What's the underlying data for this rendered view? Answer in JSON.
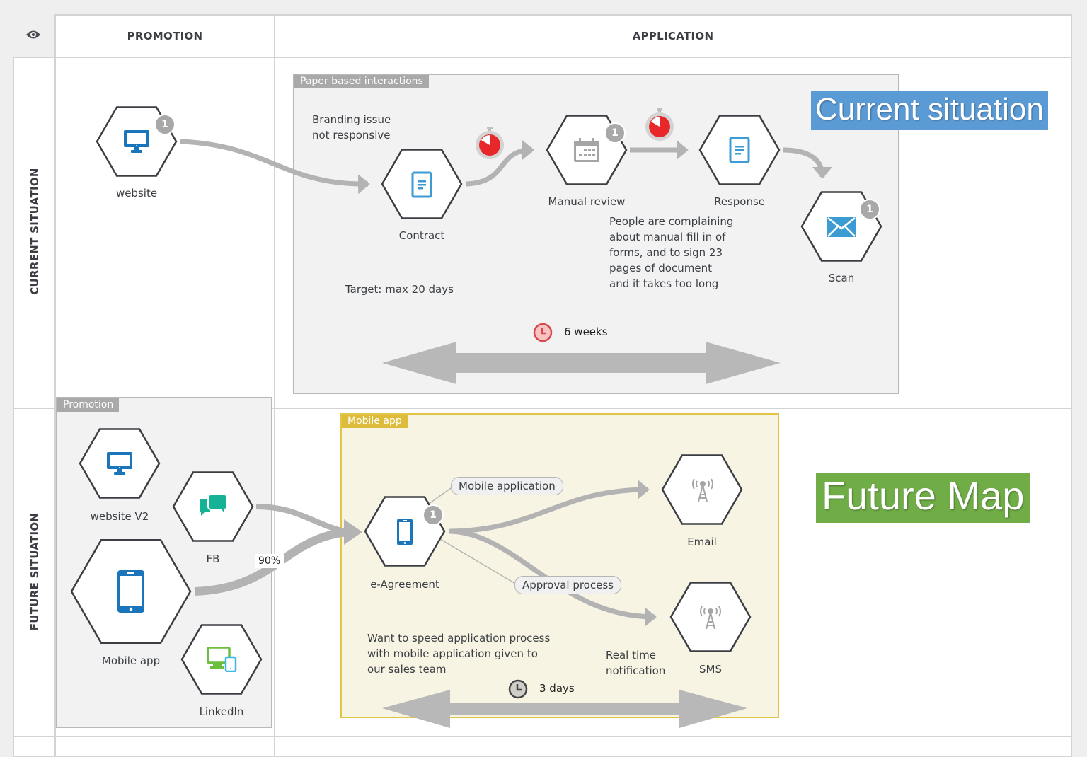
{
  "header": {
    "view_icon": "eye-icon",
    "columns": [
      "PROMOTION",
      "APPLICATION"
    ]
  },
  "rows": [
    "CURRENT SITUATION",
    "FUTURE SITUATION"
  ],
  "colors": {
    "icon_blue": "#1b75bb",
    "icon_light_blue": "#3d9bd3",
    "icon_teal": "#16b296",
    "icon_green": "#6cbf3e",
    "icon_gray": "#a5a5a5",
    "timer_red": "#e8272b",
    "banner_blue": "#5b9bd5",
    "banner_green": "#70ad47",
    "mobile_group_border": "#e2c547"
  },
  "current": {
    "banner": "Current situation",
    "promotion_nodes": [
      {
        "label": "website",
        "icon": "desktop-monitor-icon",
        "badge": "1"
      }
    ],
    "group": {
      "title": "Paper based interactions",
      "nodes": [
        {
          "label": "Contract",
          "icon": "document-icon",
          "badge": null
        },
        {
          "label": "Manual review",
          "icon": "calendar-icon",
          "badge": "1"
        },
        {
          "label": "Response",
          "icon": "document-icon",
          "badge": null
        },
        {
          "label": "Scan",
          "icon": "envelope-icon",
          "badge": "1"
        }
      ],
      "notes": {
        "branding": [
          "Branding issue",
          "not responsive"
        ],
        "complaint": [
          "People are complaining",
          "about manual fill in of",
          "forms, and to sign 23",
          "pages of document",
          "and it takes too long"
        ],
        "target": "Target: max 20 days"
      },
      "timers": [
        "stopwatch-icon",
        "stopwatch-icon"
      ],
      "duration": {
        "icon": "clock-icon",
        "text": "6 weeks"
      }
    }
  },
  "future": {
    "banner": "Future Map",
    "promotion_group": {
      "title": "Promotion",
      "nodes": [
        {
          "label": "website V2",
          "icon": "desktop-monitor-icon"
        },
        {
          "label": "FB",
          "icon": "chat-bubbles-icon"
        },
        {
          "label": "Mobile app",
          "icon": "smartphone-icon"
        },
        {
          "label": "LinkedIn",
          "icon": "multi-device-icon"
        }
      ],
      "flow_percent": "90%"
    },
    "mobile_group": {
      "title": "Mobile app",
      "nodes": [
        {
          "label": "e-Agreement",
          "icon": "smartphone-icon",
          "badge": "1"
        },
        {
          "label": "Email",
          "icon": "antenna-tower-icon"
        },
        {
          "label": "SMS",
          "icon": "antenna-tower-icon"
        }
      ],
      "callouts": [
        "Mobile application",
        "Approval process"
      ],
      "notes": {
        "speed": [
          "Want to speed application process",
          "with mobile application given to",
          "our sales team"
        ],
        "realtime": [
          "Real time",
          "notification"
        ]
      },
      "duration": {
        "icon": "clock-icon",
        "text": "3 days"
      }
    }
  }
}
